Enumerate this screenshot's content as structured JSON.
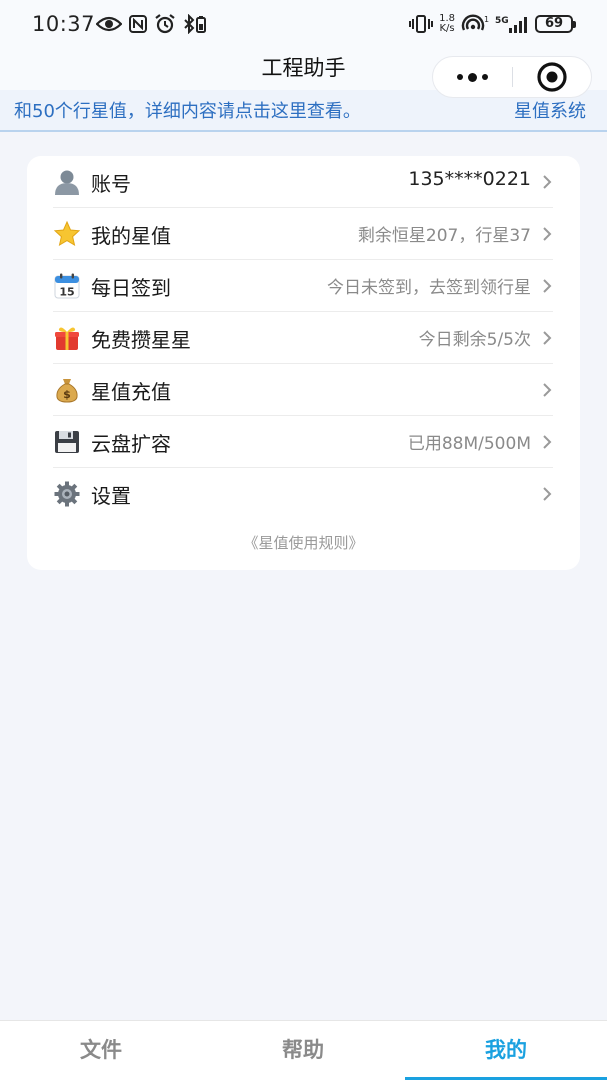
{
  "status_bar": {
    "time": "10:37",
    "net_speed_value": "1.8",
    "net_speed_unit": "K/s",
    "signal_label": "5G",
    "battery": "69"
  },
  "header": {
    "title": "工程助手"
  },
  "notice": {
    "text": "和50个行星值，详细内容请点击这里查看。",
    "text_next": "星值系统"
  },
  "menu": {
    "items": [
      {
        "label": "账号",
        "value": "135****0221",
        "icon": "user-icon"
      },
      {
        "label": "我的星值",
        "value": "剩余恒星207，行星37",
        "icon": "star-icon"
      },
      {
        "label": "每日签到",
        "value": "今日未签到，去签到领行星",
        "icon": "calendar-icon"
      },
      {
        "label": "免费攒星星",
        "value": "今日剩余5/5次",
        "icon": "gift-icon"
      },
      {
        "label": "星值充值",
        "value": "",
        "icon": "money-bag-icon"
      },
      {
        "label": "云盘扩容",
        "value": "已用88M/500M",
        "icon": "floppy-disk-icon"
      },
      {
        "label": "设置",
        "value": "",
        "icon": "gear-icon"
      }
    ],
    "calendar_day": "15",
    "money_symbol": "$",
    "rules_link": "《星值使用规则》"
  },
  "tabs": [
    {
      "label": "文件",
      "active": false
    },
    {
      "label": "帮助",
      "active": false
    },
    {
      "label": "我的",
      "active": true
    }
  ],
  "colors": {
    "accent": "#1aa1e0",
    "notice_text": "#2d6fc1",
    "background": "#f3f5fa"
  }
}
